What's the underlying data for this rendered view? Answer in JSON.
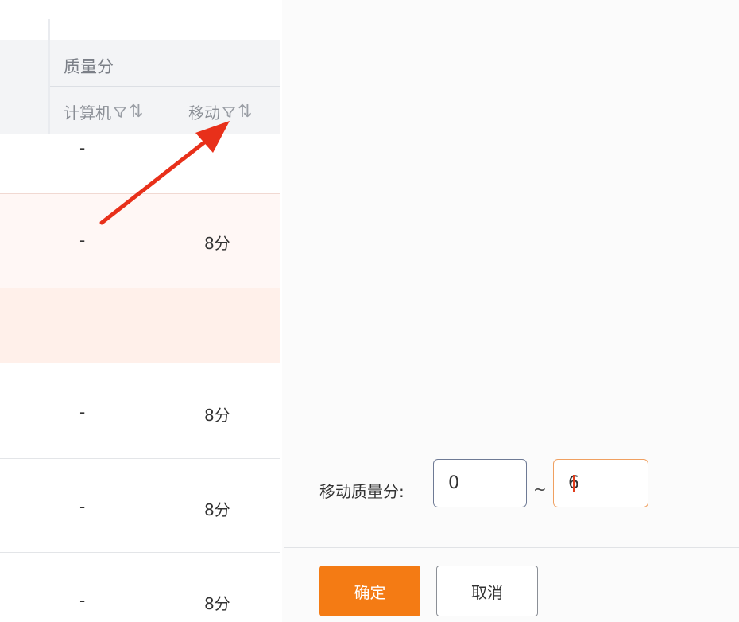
{
  "table": {
    "group_header": "质量分",
    "columns": {
      "computer": {
        "label": "计算机",
        "sort_glyph": "⇅",
        "filter_icon": "funnel-icon"
      },
      "mobile": {
        "label": "移动",
        "sort_glyph": "⇅",
        "filter_icon": "funnel-icon"
      }
    },
    "rows": [
      {
        "computer": "-",
        "mobile": ""
      },
      {
        "computer": "-",
        "mobile": "8分"
      },
      {
        "computer": "",
        "mobile": ""
      },
      {
        "computer": "-",
        "mobile": "8分"
      },
      {
        "computer": "-",
        "mobile": "8分"
      },
      {
        "computer": "-",
        "mobile": "8分"
      }
    ]
  },
  "annotation": {
    "color": "#e8301a",
    "icon": "red-arrow-icon"
  },
  "filter": {
    "label": "移动质量分:",
    "min_value": "0",
    "range_separator": "~",
    "max_value": "6",
    "confirm_label": "确定",
    "cancel_label": "取消"
  },
  "colors": {
    "accent": "#f47b14",
    "highlight_row": "#fff0ea"
  }
}
